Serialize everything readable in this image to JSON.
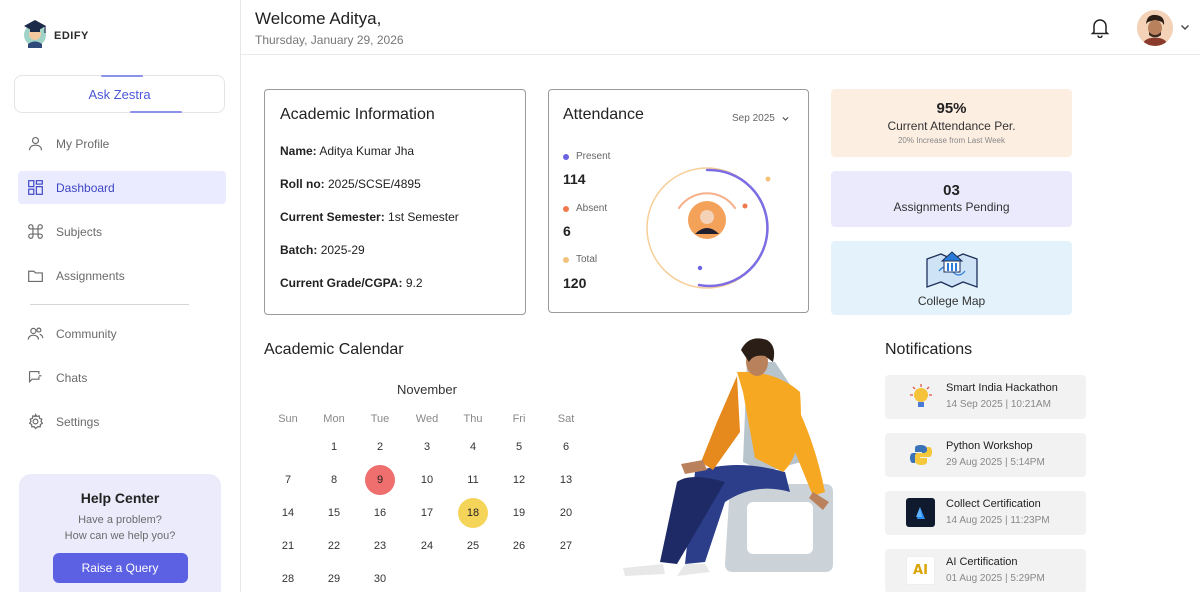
{
  "brand": {
    "name": "EDIFY"
  },
  "sidebar": {
    "ask_label": "Ask Zestra",
    "items": [
      {
        "label": "My Profile",
        "icon": "user-icon"
      },
      {
        "label": "Dashboard",
        "icon": "dashboard-icon",
        "active": true
      },
      {
        "label": "Subjects",
        "icon": "command-icon"
      },
      {
        "label": "Assignments",
        "icon": "folder-icon"
      },
      {
        "label": "Community",
        "icon": "users-icon"
      },
      {
        "label": "Chats",
        "icon": "chat-icon"
      },
      {
        "label": "Settings",
        "icon": "gear-icon"
      }
    ],
    "help": {
      "title": "Help Center",
      "line1": "Have a problem?",
      "line2": "How can we help you?",
      "button": "Raise a Query"
    }
  },
  "header": {
    "welcome": "Welcome Aditya,",
    "date": "Thursday, January 29, 2026"
  },
  "academic": {
    "title": "Academic Information",
    "rows": [
      {
        "label": "Name:",
        "value": "Aditya Kumar Jha"
      },
      {
        "label": "Roll no:",
        "value": "2025/SCSE/4895"
      },
      {
        "label": "Current Semester:",
        "value": "1st Semester"
      },
      {
        "label": "Batch:",
        "value": "2025-29"
      },
      {
        "label": "Current Grade/CGPA:",
        "value": "9.2"
      }
    ]
  },
  "attendance": {
    "title": "Attendance",
    "month": "Sep 2025",
    "present_label": "Present",
    "present_value": "114",
    "absent_label": "Absent",
    "absent_value": "6",
    "total_label": "Total",
    "total_value": "120",
    "colors": {
      "present": "#6c63e0",
      "absent": "#f07a4d",
      "total": "#f3c27a"
    }
  },
  "stats": {
    "attendance_pct": "95%",
    "attendance_label": "Current Attendance Per.",
    "attendance_sub": "20% Increase from Last Week",
    "assignments_count": "03",
    "assignments_label": "Assignments Pending",
    "map_label": "College Map"
  },
  "calendar": {
    "title": "Academic Calendar",
    "month": "November",
    "weekdays": [
      "Sun",
      "Mon",
      "Tue",
      "Wed",
      "Thu",
      "Fri",
      "Sat"
    ],
    "weeks": [
      [
        "",
        "1",
        "2",
        "3",
        "4",
        "5",
        "6"
      ],
      [
        "7",
        "8",
        "9",
        "10",
        "11",
        "12",
        "13"
      ],
      [
        "14",
        "15",
        "16",
        "17",
        "18",
        "19",
        "20"
      ],
      [
        "21",
        "22",
        "23",
        "24",
        "25",
        "26",
        "27"
      ],
      [
        "28",
        "29",
        "30",
        "",
        "",
        "",
        ""
      ]
    ],
    "highlight_red": "9",
    "highlight_yellow": "18"
  },
  "notifications": {
    "title": "Notifications",
    "items": [
      {
        "name": "Smart India Hackathon",
        "time": "14 Sep 2025 | 10:21AM",
        "icon": "bulb-icon"
      },
      {
        "name": "Python Workshop",
        "time": "29 Aug 2025 | 5:14PM",
        "icon": "python-icon"
      },
      {
        "name": "Collect Certification",
        "time": "14 Aug 2025 | 11:23PM",
        "icon": "azure-icon"
      },
      {
        "name": "AI Certification",
        "time": "01 Aug 2025 | 5:29PM",
        "icon": "ai-icon",
        "icon_text": "AI"
      }
    ]
  }
}
